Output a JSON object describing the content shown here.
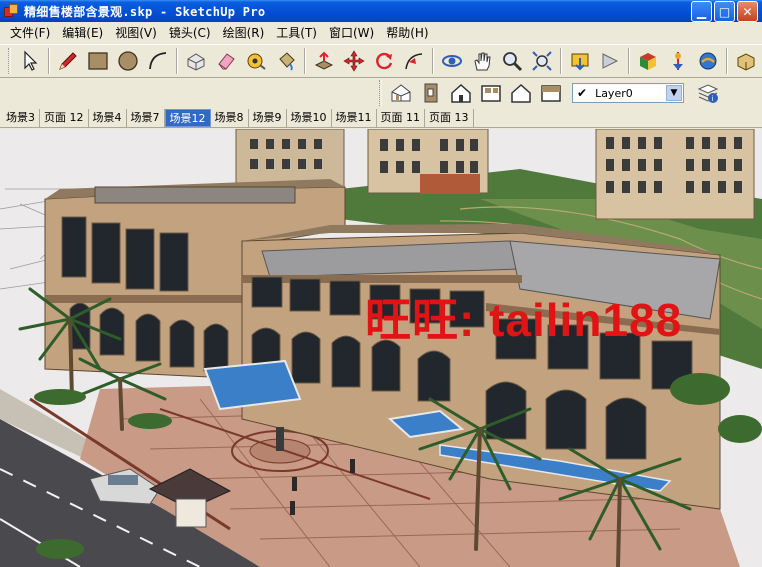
{
  "window": {
    "title": "精细售楼部含景观.skp - SketchUp Pro"
  },
  "menu": [
    {
      "label": "文件(F)"
    },
    {
      "label": "编辑(E)"
    },
    {
      "label": "视图(V)"
    },
    {
      "label": "镜头(C)"
    },
    {
      "label": "绘图(R)"
    },
    {
      "label": "工具(T)"
    },
    {
      "label": "窗口(W)"
    },
    {
      "label": "帮助(H)"
    }
  ],
  "toolbar": {
    "tools": [
      "select-icon",
      "pencil-icon",
      "rectangle-icon",
      "circle-icon",
      "arc-icon",
      "eraser-icon",
      "paint-bucket-icon",
      "tape-measure-icon",
      "push-pull-icon",
      "move-icon",
      "rotate-icon",
      "follow-me-icon",
      "orbit-icon",
      "pan-icon",
      "zoom-icon",
      "zoom-extents-icon",
      "previous-view-icon",
      "next-view-icon",
      "get-models-icon",
      "share-model-icon",
      "components-icon"
    ]
  },
  "views": [
    "iso-view-icon",
    "top-view-icon",
    "front-view-icon",
    "right-view-icon",
    "back-view-icon",
    "left-view-icon"
  ],
  "layer": {
    "value": "Layer0"
  },
  "scene_tabs": [
    {
      "label": "场景3"
    },
    {
      "label": "页面 12"
    },
    {
      "label": "场景4"
    },
    {
      "label": "场景7"
    },
    {
      "label": "场景12",
      "active": true
    },
    {
      "label": "场景8"
    },
    {
      "label": "场景9"
    },
    {
      "label": "场景10"
    },
    {
      "label": "场景11"
    },
    {
      "label": "页面 11"
    },
    {
      "label": "页面 13"
    }
  ],
  "viewport": {
    "watermark": "旺旺: tailin188"
  },
  "colors": {
    "titlebar": "#0350d6",
    "active_tab": "#316ac5",
    "watermark": "#e01414"
  }
}
